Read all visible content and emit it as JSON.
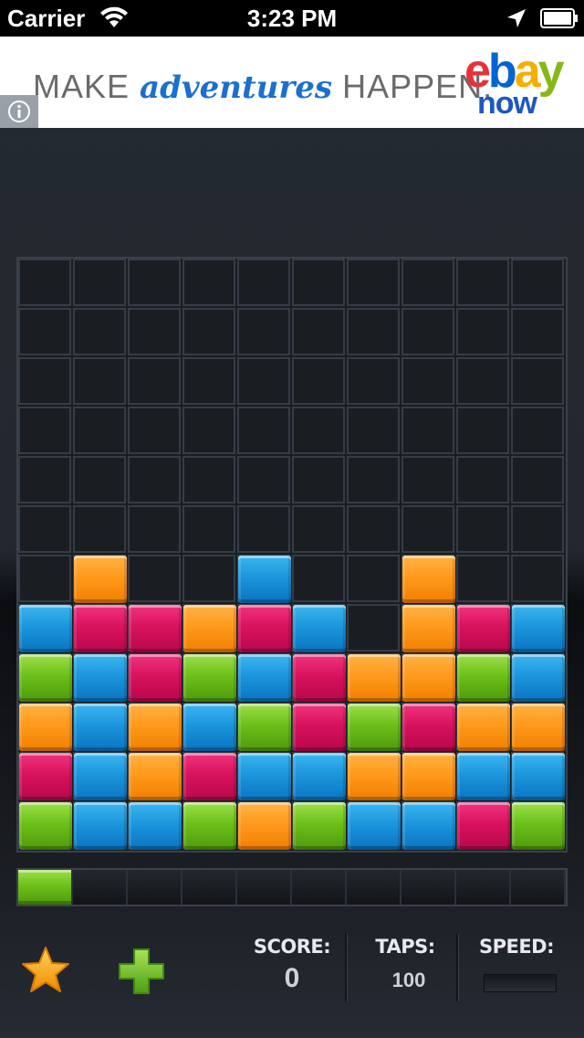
{
  "status_bar": {
    "carrier": "Carrier",
    "time": "3:23 PM"
  },
  "ad": {
    "prefix": "MAKE",
    "highlight": "adventures",
    "suffix": "HAPPEN.",
    "logo_letters": [
      "e",
      "b",
      "a",
      "y"
    ],
    "logo_colors": [
      "#e53238",
      "#0064d2",
      "#f5af02",
      "#86b817"
    ],
    "logo_sub": "now",
    "info_icon": "info-icon"
  },
  "board": {
    "columns": 10,
    "rows": 12,
    "empty_rows": 6,
    "grid": [
      [
        null,
        "orange",
        null,
        null,
        "blue",
        null,
        null,
        "orange",
        null,
        null
      ],
      [
        "blue",
        "pink",
        "pink",
        "orange",
        "pink",
        "blue",
        null,
        "orange",
        "pink",
        "blue"
      ],
      [
        "green",
        "blue",
        "pink",
        "green",
        "blue",
        "pink",
        "orange",
        "orange",
        "green",
        "blue"
      ],
      [
        "orange",
        "blue",
        "orange",
        "blue",
        "green",
        "pink",
        "green",
        "pink",
        "orange",
        "orange"
      ],
      [
        "pink",
        "blue",
        "orange",
        "pink",
        "blue",
        "blue",
        "orange",
        "orange",
        "blue",
        "blue"
      ],
      [
        "green",
        "blue",
        "blue",
        "green",
        "orange",
        "green",
        "blue",
        "blue",
        "pink",
        "green"
      ]
    ]
  },
  "next_row": {
    "slots": 10,
    "filled": [
      "green"
    ]
  },
  "controls": {
    "star_icon": "star-icon",
    "plus_icon": "plus-icon"
  },
  "stats": {
    "score_label": "SCORE:",
    "score_value": "0",
    "taps_label": "TAPS:",
    "taps_value": "100",
    "speed_label": "SPEED:",
    "speed_level": 0
  }
}
